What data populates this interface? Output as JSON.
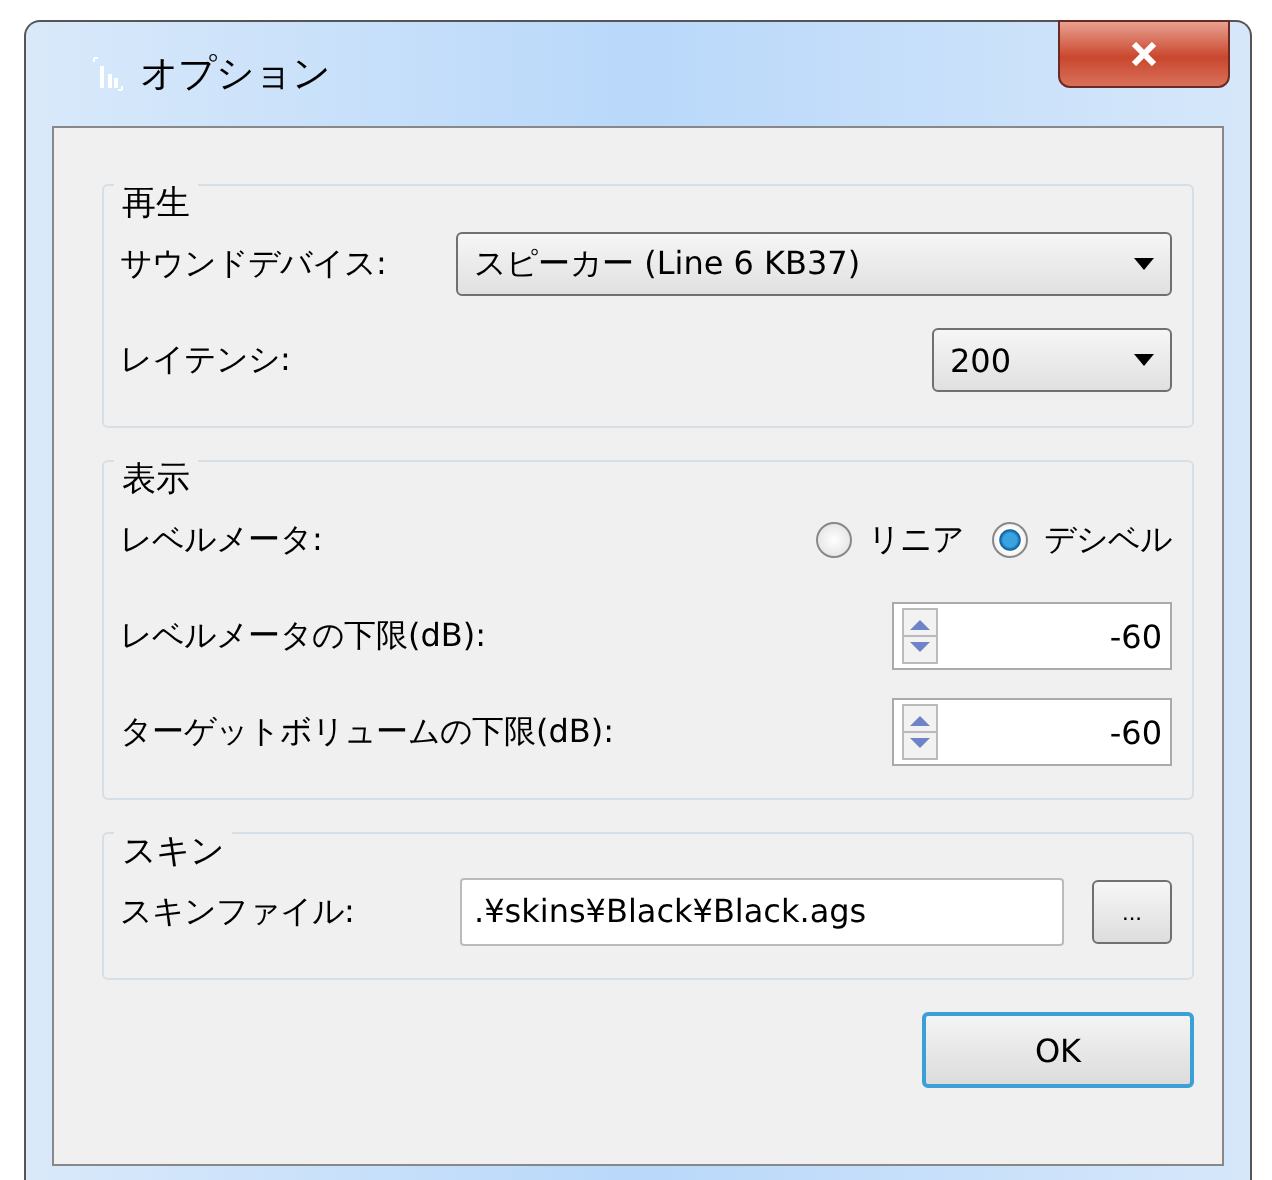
{
  "window": {
    "title": "オプション"
  },
  "groups": [
    {
      "title": "再生",
      "rows": [
        {
          "kind": "dropdown",
          "label": "サウンドデバイス:",
          "value": "スピーカー (Line 6 KB37)",
          "wide": true
        },
        {
          "kind": "dropdown",
          "label": "レイテンシ:",
          "value": "200",
          "wide": false
        }
      ]
    },
    {
      "title": "表示",
      "rows": [
        {
          "kind": "radio",
          "label": "レベルメータ:",
          "options": [
            {
              "label": "リニア",
              "selected": false
            },
            {
              "label": "デシベル",
              "selected": true
            }
          ]
        },
        {
          "kind": "spinner",
          "label": "レベルメータの下限(dB):",
          "value": "-60"
        },
        {
          "kind": "spinner",
          "label": "ターゲットボリュームの下限(dB):",
          "value": "-60"
        }
      ]
    },
    {
      "title": "スキン",
      "rows": [
        {
          "kind": "file",
          "label": "スキンファイル:",
          "value": ".¥skins¥Black¥Black.ags",
          "button": "..."
        }
      ]
    }
  ],
  "buttons": [
    "OK"
  ]
}
